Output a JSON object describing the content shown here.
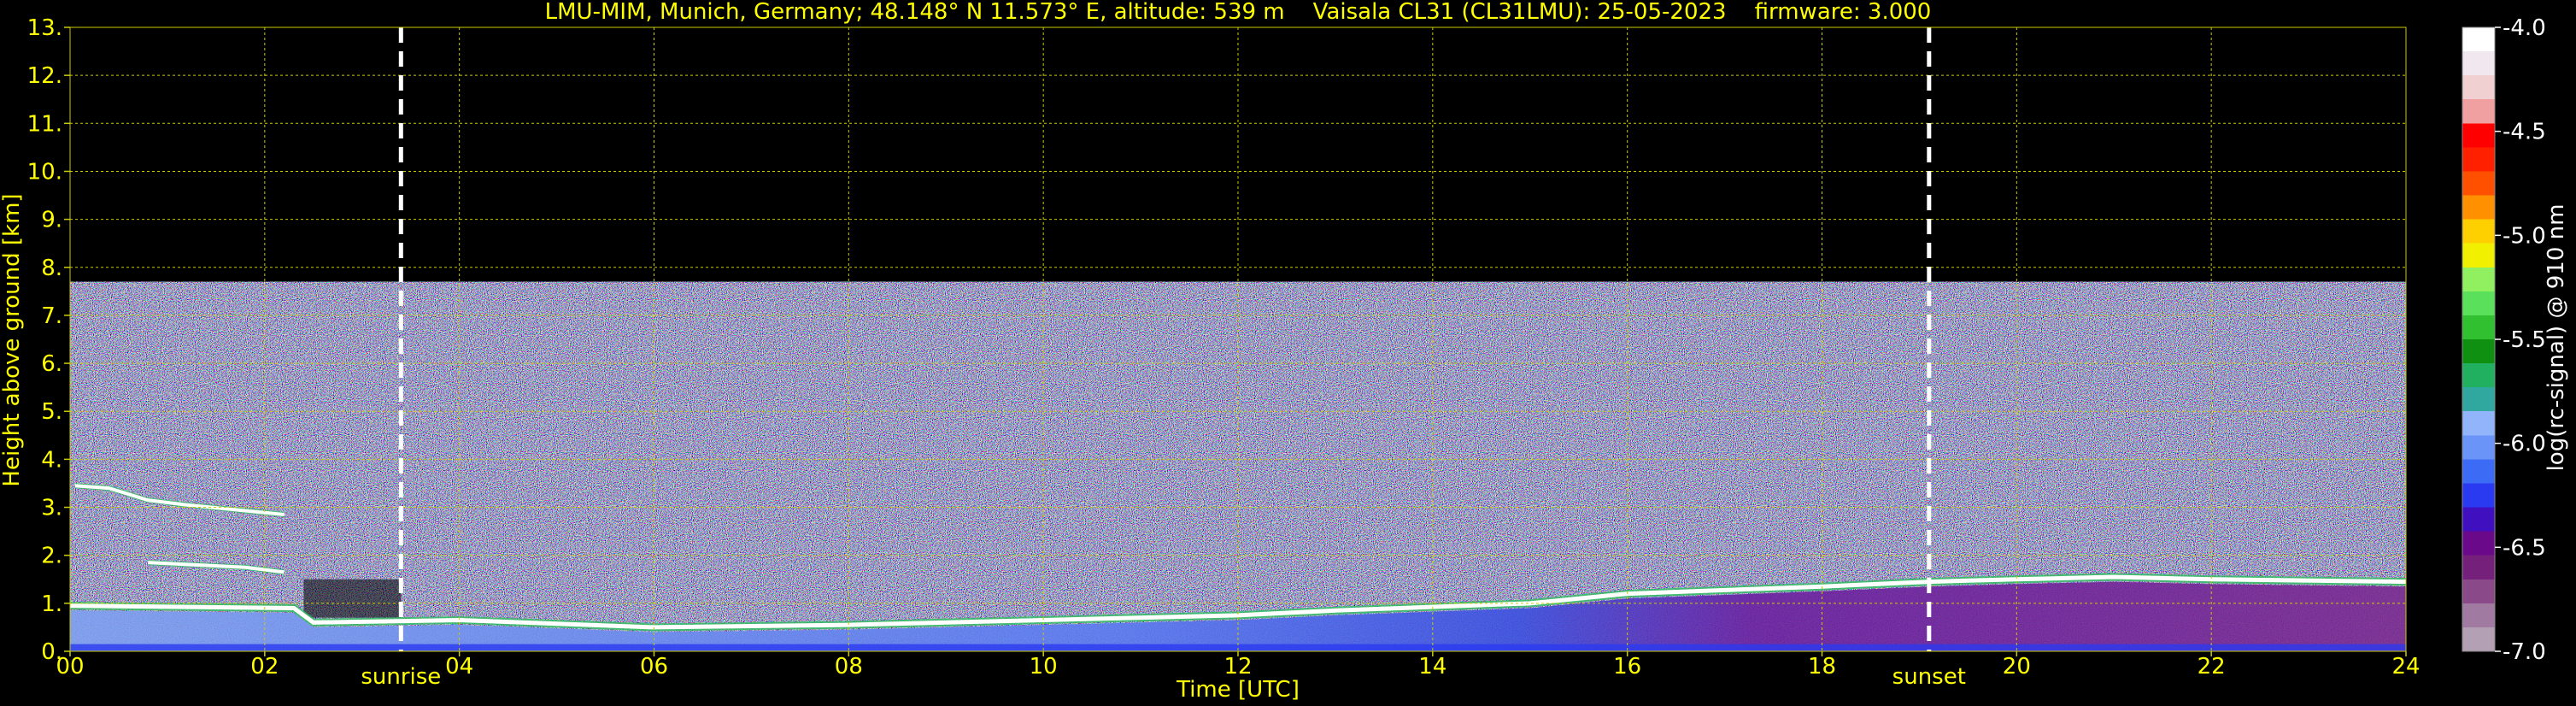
{
  "chart_data": {
    "type": "heatmap",
    "title": "LMU-MIM, Munich, Germany; 48.148° N 11.573° E, altitude: 539 m    Vaisala CL31 (CL31LMU): 25-05-2023    firmware: 3.000",
    "xlabel": "Time [UTC]",
    "ylabel": "Height above ground [km]",
    "xlim": [
      0,
      24
    ],
    "ylim": [
      0,
      13
    ],
    "x_ticks": [
      "00",
      "02",
      "04",
      "06",
      "08",
      "10",
      "12",
      "14",
      "16",
      "18",
      "20",
      "22",
      "24"
    ],
    "x_tick_values": [
      0,
      2,
      4,
      6,
      8,
      10,
      12,
      14,
      16,
      18,
      20,
      22,
      24
    ],
    "y_ticks": [
      "0.",
      "1.",
      "2.",
      "3.",
      "4.",
      "5.",
      "6.",
      "7.",
      "8.",
      "9.",
      "10.",
      "11.",
      "12.",
      "13."
    ],
    "y_tick_values": [
      0,
      1,
      2,
      3,
      4,
      5,
      6,
      7,
      8,
      9,
      10,
      11,
      12,
      13
    ],
    "grid": true,
    "data_top_km": 7.7,
    "markers": [
      {
        "label": "sunrise",
        "time": 3.4
      },
      {
        "label": "sunset",
        "time": 19.1
      }
    ],
    "colorbar": {
      "label": "log(rc-signal) @ 910 nm",
      "range": [
        -7.0,
        -4.0
      ],
      "ticks": [
        "-4.0",
        "-4.5",
        "-5.0",
        "-5.5",
        "-6.0",
        "-6.5",
        "-7.0"
      ],
      "tick_values": [
        -4.0,
        -4.5,
        -5.0,
        -5.5,
        -6.0,
        -6.5,
        -7.0
      ],
      "colors_low_to_high": [
        "#b4a0b4",
        "#a07aa0",
        "#8a4a8a",
        "#75207a",
        "#6a0a8a",
        "#4010c0",
        "#2a3af0",
        "#3c6cf5",
        "#6a94f8",
        "#92b4fa",
        "#30a8a0",
        "#20b060",
        "#109010",
        "#30c030",
        "#5ae05a",
        "#90f060",
        "#f0f000",
        "#ffd000",
        "#ff9000",
        "#ff5000",
        "#ff2000",
        "#ff0000",
        "#f0a0a0",
        "#f0d0d0",
        "#f0e8ee",
        "#ffffff"
      ]
    },
    "layers": [
      {
        "name": "boundary-layer top",
        "points": [
          [
            0,
            0.95
          ],
          [
            2.3,
            0.9
          ],
          [
            2.5,
            0.6
          ],
          [
            4,
            0.65
          ],
          [
            6,
            0.5
          ],
          [
            8,
            0.55
          ],
          [
            10,
            0.65
          ],
          [
            12,
            0.75
          ],
          [
            13,
            0.85
          ],
          [
            15,
            1.0
          ],
          [
            16,
            1.2
          ],
          [
            18,
            1.35
          ],
          [
            19.1,
            1.45
          ],
          [
            20,
            1.5
          ],
          [
            21,
            1.55
          ],
          [
            22,
            1.5
          ],
          [
            24,
            1.45
          ]
        ]
      },
      {
        "name": "aerosol layer",
        "points": [
          [
            0.8,
            1.85
          ],
          [
            1.8,
            1.75
          ],
          [
            2.2,
            1.65
          ]
        ]
      },
      {
        "name": "upper layer",
        "points": [
          [
            0.05,
            3.45
          ],
          [
            0.4,
            3.4
          ],
          [
            0.8,
            3.15
          ],
          [
            1.2,
            3.05
          ],
          [
            2.2,
            2.85
          ]
        ]
      }
    ]
  }
}
